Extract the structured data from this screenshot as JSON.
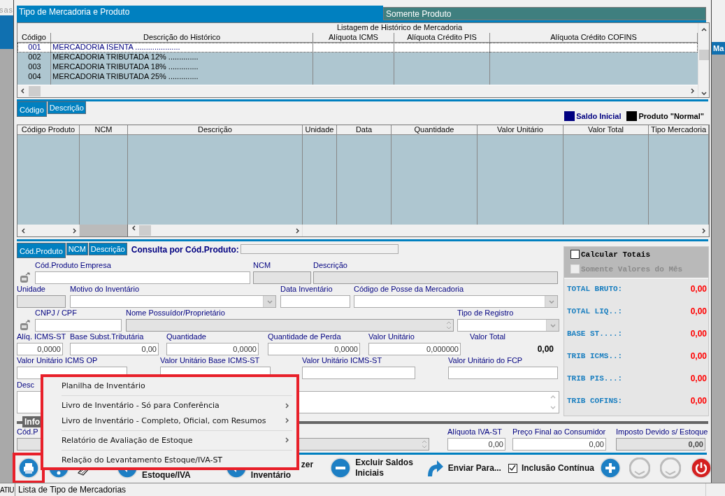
{
  "side_left": {
    "top_text": "sas",
    "bottom_text": "ATIU"
  },
  "side_right": {
    "band_text": "Ma"
  },
  "main_tabs": [
    {
      "label": "Tipo de Mercadoria e Produto",
      "selected": true
    },
    {
      "label": "Somente Produto",
      "selected": false
    }
  ],
  "history_grid": {
    "title": "Listagem de Histórico de Mercadoria",
    "columns": [
      "Código",
      "Descrição do Histórico",
      "Alíquota ICMS",
      "Alíquota Crédito PIS",
      "Alíquota Crédito COFINS"
    ],
    "rows": [
      {
        "code": "001",
        "description": "MERCADORIA ISENTA .....................",
        "selected": true
      },
      {
        "code": "002",
        "description": "MERCADORIA TRIBUTADA 12% ..............",
        "selected": false
      },
      {
        "code": "003",
        "description": "MERCADORIA TRIBUTADA 18% ..............",
        "selected": false
      },
      {
        "code": "004",
        "description": "MERCADORIA TRIBUTADA 25% ..............",
        "selected": false
      }
    ]
  },
  "sort_tabs": [
    {
      "label": "Código",
      "selected": true
    },
    {
      "label": "Descrição",
      "selected": false
    }
  ],
  "legend": [
    {
      "label": "Saldo Inicial",
      "color": "#000080"
    },
    {
      "label": "Produto \"Normal\"",
      "color": "#000000"
    }
  ],
  "product_grid": {
    "columns": [
      "Código Produto",
      "NCM",
      "Descrição",
      "Unidade",
      "Data",
      "Quantidade",
      "Valor Unitário",
      "Valor Total",
      "Tipo Mercadoria"
    ]
  },
  "search_tabs": [
    {
      "label": "Cód.Produto",
      "selected": true
    },
    {
      "label": "NCM",
      "selected": false
    },
    {
      "label": "Descrição",
      "selected": false
    }
  ],
  "search": {
    "label": "Consulta por Cód.Produto:"
  },
  "form_rows": [
    [
      {
        "label": "Cód.Produto Empresa",
        "kind": "input",
        "lookup": true
      },
      {
        "label": "NCM",
        "kind": "readonly"
      },
      {
        "label": "Descrição",
        "kind": "readonly"
      }
    ],
    [
      {
        "label": "Unidade",
        "kind": "readonly"
      },
      {
        "label": "Motivo do Inventário",
        "kind": "select"
      },
      {
        "label": "Data Inventário",
        "kind": "input"
      },
      {
        "label": "Código de Posse da Mercadoria",
        "kind": "select"
      }
    ],
    [
      {
        "label": "CNPJ / CPF",
        "kind": "input",
        "lookup": true
      },
      {
        "label": "Nome Possuídor/Proprietário",
        "kind": "spin"
      },
      {
        "label": "Tipo de Registro",
        "kind": "select"
      }
    ],
    [
      {
        "label": "Alíq. ICMS-ST",
        "kind": "input",
        "value": "0,0000"
      },
      {
        "label": "Base Subst.Tributária",
        "kind": "input",
        "value": "0,00"
      },
      {
        "label": "Quantidade",
        "kind": "input",
        "value": "0,0000"
      },
      {
        "label": "Quantidade de Perda",
        "kind": "input",
        "value": "0,0000"
      },
      {
        "label": "Valor Unitário",
        "kind": "input",
        "value": "0,000000"
      },
      {
        "label": "Valor Total",
        "kind": "static",
        "value": "0,00"
      }
    ],
    [
      {
        "label": "Valor Unitário ICMS OP",
        "kind": "input"
      },
      {
        "label": "Valor Unitário Base ICMS-ST",
        "kind": "input"
      },
      {
        "label": "Valor Unitário ICMS-ST",
        "kind": "input"
      },
      {
        "label": "Valor Unitário do FCP",
        "kind": "input"
      }
    ],
    [
      {
        "label": "Desc",
        "kind": "memo"
      }
    ]
  ],
  "group_label": "Info",
  "lower_row": [
    {
      "label": "Cód.P",
      "kind": "spin"
    },
    {
      "label": "Alíquota IVA-ST",
      "kind": "input",
      "value": "0,00"
    },
    {
      "label": "Preço Final ao Consumidor",
      "kind": "input",
      "value": "0,00"
    },
    {
      "label": "Imposto Devido s/ Estoque",
      "kind": "readonly",
      "value": "0,00"
    }
  ],
  "totals": {
    "options": [
      {
        "label": "Calcular Totais",
        "checked": false,
        "disabled": false
      },
      {
        "label": "Somente Valores do Mês",
        "checked": false,
        "disabled": true
      }
    ],
    "rows": [
      {
        "label": "TOTAL BRUTO:",
        "value": "0,00"
      },
      {
        "label": "TOTAL LIQ..:",
        "value": "0,00"
      },
      {
        "label": "BASE ST....:",
        "value": "0,00"
      },
      {
        "label": "TRIB ICMS..:",
        "value": "0,00"
      },
      {
        "label": "TRIB PIS...:",
        "value": "0,00"
      },
      {
        "label": "TRIB COFINS:",
        "value": "0,00"
      }
    ]
  },
  "toolbar": [
    {
      "kind": "print",
      "highlighted": true
    },
    {
      "kind": "help"
    },
    {
      "kind": "tools"
    },
    {
      "kind": "back",
      "lines": [
        "Estoque/IVA"
      ]
    },
    {
      "kind": "back",
      "lines": [
        "zer",
        "Inventário"
      ]
    },
    {
      "kind": "minus",
      "lines": [
        "Excluir Saldos",
        "Iniciais"
      ]
    },
    {
      "kind": "send",
      "lines": [
        "Enviar Para..."
      ]
    },
    {
      "kind": "checkbox",
      "lines": [
        "Inclusão Contínua"
      ],
      "checked": true
    },
    {
      "kind": "plus"
    },
    {
      "kind": "blank"
    },
    {
      "kind": "blank"
    },
    {
      "kind": "power"
    }
  ],
  "context_menu": {
    "highlighted": true,
    "items": [
      {
        "kind": "item",
        "label": "Planilha de Inventário",
        "submenu": false
      },
      {
        "kind": "separator"
      },
      {
        "kind": "item",
        "label": "Livro de Inventário - Só para Conferência",
        "submenu": true
      },
      {
        "kind": "item",
        "label": "Livro de Inventário - Completo, Oficial, com Resumos",
        "submenu": true
      },
      {
        "kind": "separator"
      },
      {
        "kind": "item",
        "label": "Relatório de Avaliação de Estoque",
        "submenu": true
      },
      {
        "kind": "separator"
      },
      {
        "kind": "item",
        "label": "Relação do Levantamento Estoque/IVA-ST",
        "submenu": false
      }
    ]
  },
  "status_bar": {
    "text": "Lista de Tipo de Mercadorias"
  }
}
